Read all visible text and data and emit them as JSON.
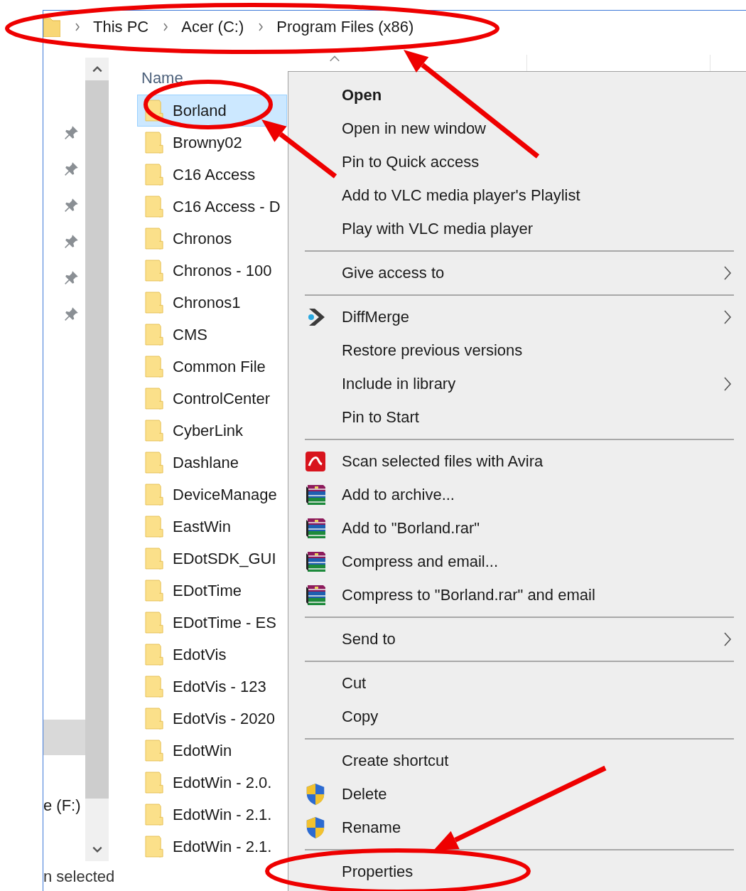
{
  "address_bar": {
    "breadcrumbs": [
      "This PC",
      "Acer (C:)",
      "Program Files (x86)"
    ]
  },
  "navigation_pane": {
    "quick_access": [
      {
        "pinned": true
      },
      {
        "pinned": true
      },
      {
        "pinned": true
      },
      {
        "pinned": true
      },
      {
        "pinned": true
      },
      {
        "pinned": true
      }
    ],
    "items": [
      {
        "selected": true
      },
      {
        "label": "e (F:)",
        "selected": false
      }
    ]
  },
  "file_list": {
    "columns": [
      "Name"
    ],
    "rows": [
      {
        "name": "Borland",
        "selected": true
      },
      {
        "name": "Browny02",
        "selected": false
      },
      {
        "name": "C16 Access",
        "selected": false
      },
      {
        "name": "C16 Access - D",
        "selected": false
      },
      {
        "name": "Chronos",
        "selected": false
      },
      {
        "name": "Chronos - 100",
        "selected": false
      },
      {
        "name": "Chronos1",
        "selected": false
      },
      {
        "name": "CMS",
        "selected": false
      },
      {
        "name": "Common File",
        "selected": false
      },
      {
        "name": "ControlCenter",
        "selected": false
      },
      {
        "name": "CyberLink",
        "selected": false
      },
      {
        "name": "Dashlane",
        "selected": false
      },
      {
        "name": "DeviceManage",
        "selected": false
      },
      {
        "name": "EastWin",
        "selected": false
      },
      {
        "name": "EDotSDK_GUI",
        "selected": false
      },
      {
        "name": "EDotTime",
        "selected": false
      },
      {
        "name": "EDotTime - ES",
        "selected": false
      },
      {
        "name": "EdotVis",
        "selected": false
      },
      {
        "name": "EdotVis - 123",
        "selected": false
      },
      {
        "name": "EdotVis - 2020",
        "selected": false
      },
      {
        "name": "EdotWin",
        "selected": false
      },
      {
        "name": "EdotWin - 2.0.",
        "selected": false
      },
      {
        "name": "EdotWin - 2.1.",
        "selected": false
      },
      {
        "name": "EdotWin - 2.1.",
        "selected": false
      }
    ]
  },
  "context_menu": {
    "items": [
      {
        "kind": "item",
        "label": "Open",
        "default": true,
        "submenu": false
      },
      {
        "kind": "item",
        "label": "Open in new window",
        "default": false,
        "submenu": false
      },
      {
        "kind": "item",
        "label": "Pin to Quick access",
        "default": false,
        "submenu": false
      },
      {
        "kind": "item",
        "label": "Add to VLC media player's Playlist",
        "default": false,
        "submenu": false
      },
      {
        "kind": "item",
        "label": "Play with VLC media player",
        "default": false,
        "submenu": false
      },
      {
        "kind": "separator"
      },
      {
        "kind": "item",
        "label": "Give access to",
        "default": false,
        "submenu": true
      },
      {
        "kind": "separator"
      },
      {
        "kind": "item",
        "label": "DiffMerge",
        "default": false,
        "submenu": true
      },
      {
        "kind": "item",
        "label": "Restore previous versions",
        "default": false,
        "submenu": false
      },
      {
        "kind": "item",
        "label": "Include in library",
        "default": false,
        "submenu": true
      },
      {
        "kind": "item",
        "label": "Pin to Start",
        "default": false,
        "submenu": false
      },
      {
        "kind": "separator"
      },
      {
        "kind": "item",
        "label": "Scan selected files with Avira",
        "default": false,
        "submenu": false
      },
      {
        "kind": "item",
        "label": "Add to archive...",
        "default": false,
        "submenu": false
      },
      {
        "kind": "item",
        "label": "Add to \"Borland.rar\"",
        "default": false,
        "submenu": false
      },
      {
        "kind": "item",
        "label": "Compress and email...",
        "default": false,
        "submenu": false
      },
      {
        "kind": "item",
        "label": "Compress to \"Borland.rar\" and email",
        "default": false,
        "submenu": false
      },
      {
        "kind": "separator"
      },
      {
        "kind": "item",
        "label": "Send to",
        "default": false,
        "submenu": true
      },
      {
        "kind": "separator"
      },
      {
        "kind": "item",
        "label": "Cut",
        "default": false,
        "submenu": false
      },
      {
        "kind": "item",
        "label": "Copy",
        "default": false,
        "submenu": false
      },
      {
        "kind": "separator"
      },
      {
        "kind": "item",
        "label": "Create shortcut",
        "default": false,
        "submenu": false
      },
      {
        "kind": "item",
        "label": "Delete",
        "default": false,
        "submenu": false
      },
      {
        "kind": "item",
        "label": "Rename",
        "default": false,
        "submenu": false
      },
      {
        "kind": "separator"
      },
      {
        "kind": "item",
        "label": "Properties",
        "default": false,
        "submenu": false
      }
    ]
  },
  "status_bar": {
    "text": "n selected"
  },
  "annotations": [
    {
      "kind": "ellipse"
    },
    {
      "kind": "ellipse"
    },
    {
      "kind": "ellipse"
    },
    {
      "kind": "arrow"
    },
    {
      "kind": "arrow"
    },
    {
      "kind": "arrow"
    }
  ]
}
